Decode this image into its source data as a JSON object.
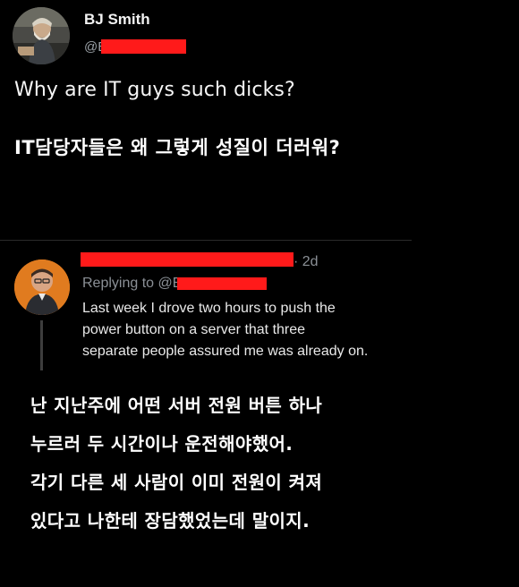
{
  "post": {
    "author_name": "BJ Smith",
    "handle_prefix": "@E",
    "text": "Why are IT guys such dicks?",
    "translation": "IT담당자들은 왜 그렇게 성질이 더러워?"
  },
  "reply": {
    "time": "· 2d",
    "replying_to_prefix": "Replying to @E",
    "text_lines": [
      "Last week I drove two hours to push the",
      "power button on a server that three",
      "separate people assured me was already on."
    ],
    "translation_lines": [
      "난 지난주에 어떤 서버 전원 버튼 하나",
      "누르러 두 시간이나 운전해야했어.",
      "각기 다른 세 사람이 이미 전원이 켜져",
      "있다고 나한테 장담했었는데 말이지."
    ]
  },
  "colors": {
    "background": "#000000",
    "redaction": "#ff1a1a",
    "muted_text": "#8b9096",
    "avatar_reply_bg": "#e07b1f"
  },
  "icons": {
    "main_avatar": "bearded-man-avatar",
    "reply_avatar": "man-portrait-avatar"
  }
}
